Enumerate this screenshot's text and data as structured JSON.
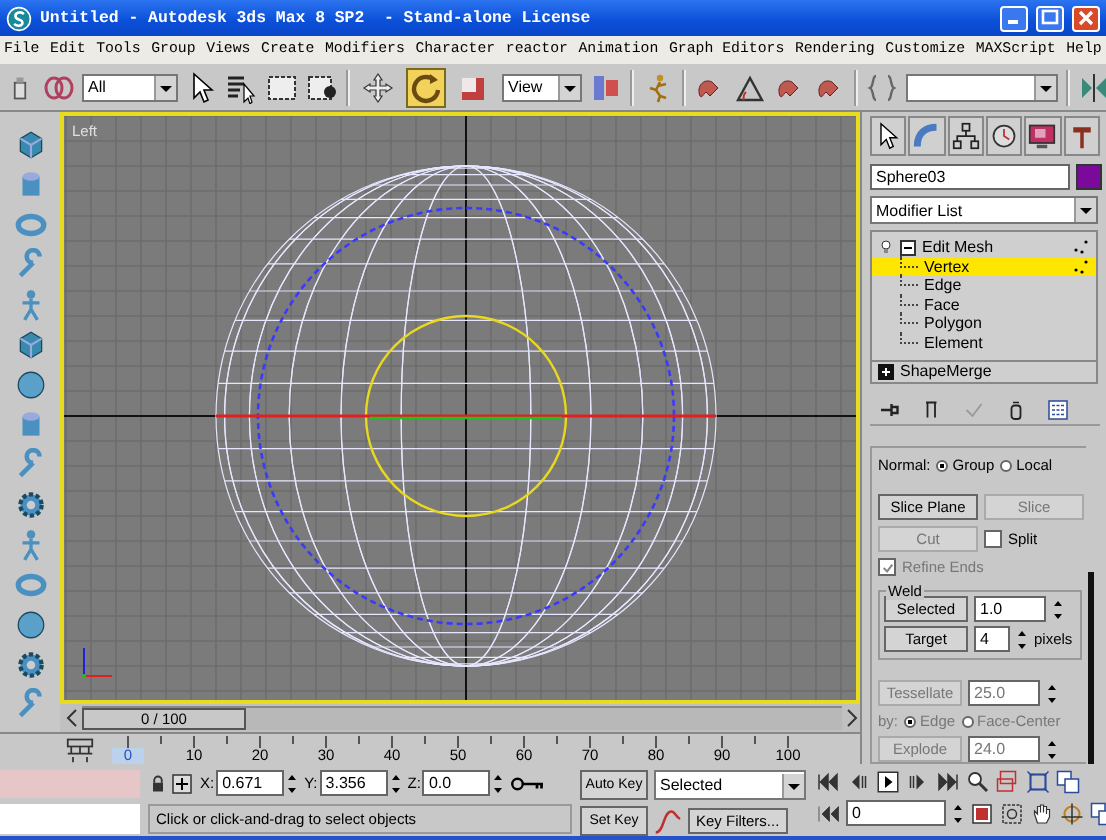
{
  "window": {
    "title": "Untitled - Autodesk 3ds Max 8 SP2  - Stand-alone License"
  },
  "menu": [
    "File",
    "Edit",
    "Tools",
    "Group",
    "Views",
    "Create",
    "Modifiers",
    "Character",
    "reactor",
    "Animation",
    "Graph Editors",
    "Rendering",
    "Customize",
    "MAXScript",
    "Help"
  ],
  "main_toolbar": {
    "selection_filter": "All",
    "reference_coordinates": "View",
    "transform_tools": [
      {
        "kind": "move",
        "selected": false
      },
      {
        "kind": "rotate",
        "selected": true
      },
      {
        "kind": "scale",
        "selected": false
      }
    ]
  },
  "viewport": {
    "label": "Left"
  },
  "time_slider": {
    "text": "0 / 100",
    "level": 0
  },
  "command_panel": {
    "object": {
      "name": "Sphere03",
      "color": "#7a0a9a"
    },
    "modifier_list": "Modifier List",
    "stack": [
      {
        "label": "Edit Mesh",
        "selected": false,
        "expanded": true,
        "children": [
          {
            "label": "Vertex",
            "selected": true
          },
          {
            "label": "Edge",
            "selected": false
          },
          {
            "label": "Face",
            "selected": false
          },
          {
            "label": "Polygon",
            "selected": false
          },
          {
            "label": "Element",
            "selected": false
          }
        ]
      },
      {
        "label": "ShapeMerge",
        "selected": false,
        "expanded": false
      }
    ],
    "edit_geometry": {
      "normal_label": "Normal:",
      "normal_options": [
        {
          "label": "Group",
          "selected": true
        },
        {
          "label": "Local",
          "selected": false
        }
      ],
      "slice_plane": {
        "label": "Slice Plane",
        "disabled": false
      },
      "slice": {
        "label": "Slice",
        "disabled": true
      },
      "cut": {
        "label": "Cut",
        "disabled": true
      },
      "split": {
        "label": "Split",
        "checked": false,
        "disabled": false
      },
      "refine_ends": {
        "label": "Refine Ends",
        "checked": true,
        "disabled": true
      },
      "weld": {
        "title": "Weld",
        "selected_button": "Selected",
        "selected_value": "1.0",
        "target_button": "Target",
        "target_value": "4",
        "target_unit": "pixels"
      },
      "tessellate": {
        "label": "Tessellate",
        "value": "25.0",
        "disabled": true
      },
      "by_label": "by:",
      "by_options": [
        {
          "label": "Edge",
          "selected": true
        },
        {
          "label": "Face-Center",
          "selected": false
        }
      ],
      "explode": {
        "label": "Explode",
        "value": "24.0",
        "disabled": true
      }
    }
  },
  "track_bar": {
    "labels": [
      "0",
      "10",
      "20",
      "30",
      "40",
      "50",
      "60",
      "70",
      "80",
      "90",
      "100"
    ]
  },
  "coordinates": [
    {
      "axis": "X:",
      "value": "0.671"
    },
    {
      "axis": "Y:",
      "value": "3.356"
    },
    {
      "axis": "Z:",
      "value": "0.0"
    }
  ],
  "prompt": "Click or click-and-drag to select objects",
  "animation": {
    "auto_key": "Auto Key",
    "set_key": "Set Key",
    "key_mode": "Selected",
    "key_filters": "Key Filters...",
    "current_frame": "0"
  }
}
